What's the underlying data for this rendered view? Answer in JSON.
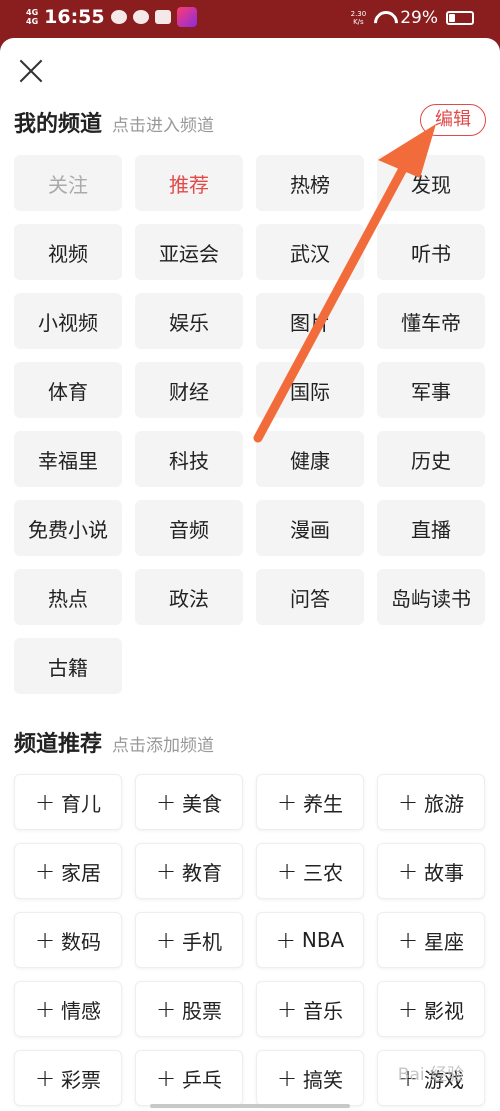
{
  "status_bar": {
    "signal": "4G\n4G",
    "time": "16:55",
    "network_speed": "2.30\nK/s",
    "battery_percent": "29%",
    "battery_level": 0.29
  },
  "my_channels": {
    "title": "我的频道",
    "hint": "点击进入频道",
    "edit_label": "编辑",
    "items": [
      {
        "label": "关注",
        "state": "muted"
      },
      {
        "label": "推荐",
        "state": "active"
      },
      {
        "label": "热榜",
        "state": ""
      },
      {
        "label": "发现",
        "state": ""
      },
      {
        "label": "视频",
        "state": ""
      },
      {
        "label": "亚运会",
        "state": ""
      },
      {
        "label": "武汉",
        "state": ""
      },
      {
        "label": "听书",
        "state": ""
      },
      {
        "label": "小视频",
        "state": ""
      },
      {
        "label": "娱乐",
        "state": ""
      },
      {
        "label": "图片",
        "state": ""
      },
      {
        "label": "懂车帝",
        "state": ""
      },
      {
        "label": "体育",
        "state": ""
      },
      {
        "label": "财经",
        "state": ""
      },
      {
        "label": "国际",
        "state": ""
      },
      {
        "label": "军事",
        "state": ""
      },
      {
        "label": "幸福里",
        "state": ""
      },
      {
        "label": "科技",
        "state": ""
      },
      {
        "label": "健康",
        "state": ""
      },
      {
        "label": "历史",
        "state": ""
      },
      {
        "label": "免费小说",
        "state": ""
      },
      {
        "label": "音频",
        "state": ""
      },
      {
        "label": "漫画",
        "state": ""
      },
      {
        "label": "直播",
        "state": ""
      },
      {
        "label": "热点",
        "state": ""
      },
      {
        "label": "政法",
        "state": ""
      },
      {
        "label": "问答",
        "state": ""
      },
      {
        "label": "岛屿读书",
        "state": ""
      },
      {
        "label": "古籍",
        "state": ""
      }
    ]
  },
  "recommended_channels": {
    "title": "频道推荐",
    "hint": "点击添加频道",
    "plus_symbol": "+",
    "items": [
      "育儿",
      "美食",
      "养生",
      "旅游",
      "家居",
      "教育",
      "三农",
      "故事",
      "数码",
      "手机",
      "NBA",
      "星座",
      "情感",
      "股票",
      "音乐",
      "影视",
      "彩票",
      "乒乓",
      "搞笑",
      "游戏"
    ]
  },
  "colors": {
    "accent": "#e24a4a",
    "status_bar_bg": "#8a1d1d",
    "annotation_arrow": "#f26b3a"
  },
  "watermark": "Bai 经验"
}
